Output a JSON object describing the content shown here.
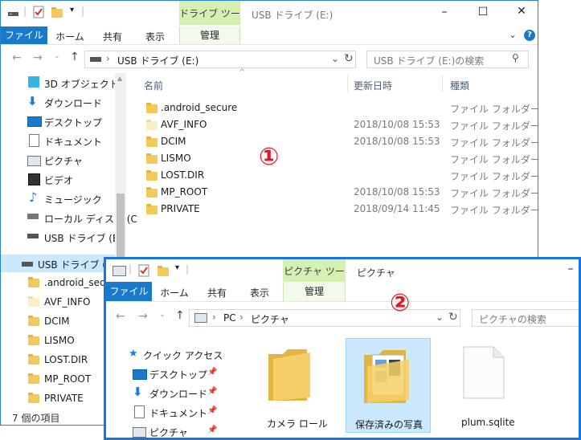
{
  "window1": {
    "title": "USB ドライブ (E:)",
    "context_tab": "ドライブ ツール",
    "context_tab_sub": "管理",
    "tabs": [
      "ファイル",
      "ホーム",
      "共有",
      "表示"
    ],
    "address": {
      "icon": "usb-drive-icon",
      "path": [
        "USB ドライブ (E:)"
      ]
    },
    "search_placeholder": "USB ドライブ (E:)の検索",
    "nav": [
      {
        "label": "3D オブジェクト",
        "icon": "3d-objects-icon"
      },
      {
        "label": "ダウンロード",
        "icon": "download-icon"
      },
      {
        "label": "デスクトップ",
        "icon": "desktop-icon"
      },
      {
        "label": "ドキュメント",
        "icon": "document-icon"
      },
      {
        "label": "ピクチャ",
        "icon": "pictures-icon"
      },
      {
        "label": "ビデオ",
        "icon": "video-icon"
      },
      {
        "label": "ミュージック",
        "icon": "music-icon"
      },
      {
        "label": "ローカル ディスク (C",
        "icon": "local-disk-icon"
      },
      {
        "label": "USB ドライブ (E:)",
        "icon": "usb-drive-icon"
      }
    ],
    "nav_drive_selected": "USB ドライブ (E:)",
    "nav_drive_children": [
      ".android_secur",
      "AVF_INFO",
      "DCIM",
      "LISMO",
      "LOST.DIR",
      "MP_ROOT",
      "PRIVATE"
    ],
    "columns": [
      "名前",
      "更新日時",
      "種類"
    ],
    "files": [
      {
        "name": ".android_secure",
        "date": "",
        "type": "ファイル フォルダー"
      },
      {
        "name": "AVF_INFO",
        "date": "2018/10/08 15:53",
        "type": "ファイル フォルダー"
      },
      {
        "name": "DCIM",
        "date": "2018/10/08 15:53",
        "type": "ファイル フォルダー"
      },
      {
        "name": "LISMO",
        "date": "",
        "type": "ファイル フォルダー"
      },
      {
        "name": "LOST.DIR",
        "date": "",
        "type": "ファイル フォルダー"
      },
      {
        "name": "MP_ROOT",
        "date": "2018/10/08 15:53",
        "type": "ファイル フォルダー"
      },
      {
        "name": "PRIVATE",
        "date": "2018/09/14 11:45",
        "type": "ファイル フォルダー"
      }
    ],
    "status": "7 個の項目",
    "marker": "①"
  },
  "window2": {
    "title": "ピクチャ",
    "context_tab": "ピクチャ ツール",
    "context_tab_sub": "管理",
    "tabs": [
      "ファイル",
      "ホーム",
      "共有",
      "表示"
    ],
    "address": {
      "path": [
        "PC",
        "ピクチャ"
      ]
    },
    "search_placeholder": "ピクチャの検索",
    "nav": [
      {
        "label": "クイック アクセス",
        "icon": "star-icon"
      },
      {
        "label": "デスクトップ",
        "icon": "desktop-icon"
      },
      {
        "label": "ダウンロード",
        "icon": "download-icon"
      },
      {
        "label": "ドキュメント",
        "icon": "document-icon"
      },
      {
        "label": "ピクチャ",
        "icon": "pictures-icon"
      }
    ],
    "items": [
      {
        "name": "カメラ ロール",
        "icon": "folder-icon"
      },
      {
        "name": "保存済みの写真",
        "icon": "folder-icon"
      },
      {
        "name": "plum.sqlite",
        "icon": "file-icon"
      }
    ],
    "marker": "②"
  },
  "colors": {
    "accent": "#1979ca",
    "context_tab": "#d6f0b4",
    "marker": "#e8141f",
    "selection": "#cce8ff"
  }
}
